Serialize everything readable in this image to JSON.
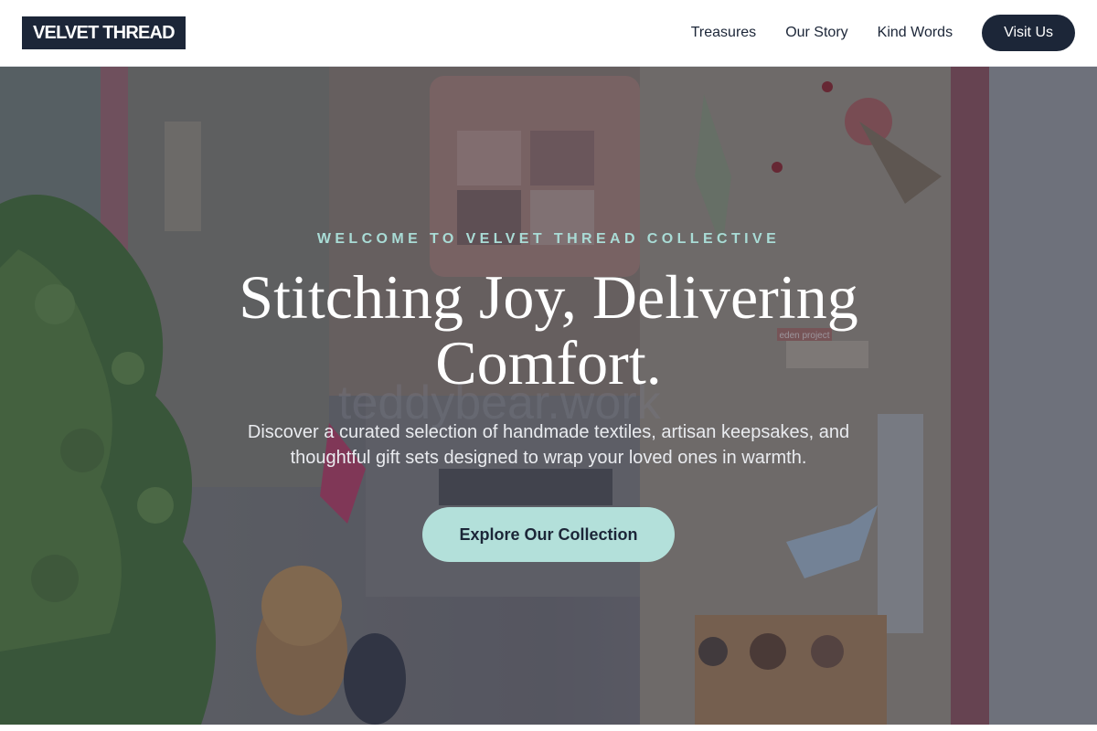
{
  "header": {
    "logo_text": "VELVET THREAD",
    "nav": [
      {
        "label": "Treasures"
      },
      {
        "label": "Our Story"
      },
      {
        "label": "Kind Words"
      }
    ],
    "visit_label": "Visit Us"
  },
  "hero": {
    "eyebrow": "WELCOME TO VELVET THREAD COLLECTIVE",
    "headline": "Stitching Joy, Delivering Comfort.",
    "subtext": "Discover a curated selection of handmade textiles, artisan keepsakes, and thoughtful gift sets designed to wrap your loved ones in warmth.",
    "cta_label": "Explore Our Collection",
    "window_sign": "teddybear.work",
    "tag_text": "eden project"
  },
  "colors": {
    "navy": "#1c2638",
    "mint": "#b3e0da",
    "eyebrow": "#a9dcd6",
    "white": "#ffffff"
  }
}
